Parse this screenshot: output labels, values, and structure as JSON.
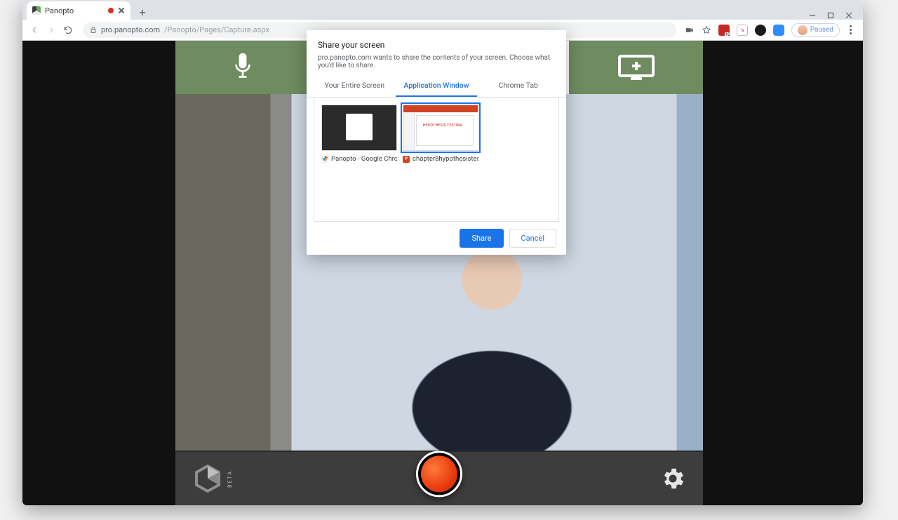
{
  "browser": {
    "tab_title": "Panopto",
    "url_host": "pro.panopto.com",
    "url_path": "/Panopto/Pages/Capture.aspx",
    "paused_label": "Paused"
  },
  "panopto": {
    "beta_label": "BETA"
  },
  "dialog": {
    "title": "Share your screen",
    "subtitle": "pro.panopto.com wants to share the contents of your screen. Choose what you'd like to share.",
    "tabs": {
      "entire": "Your Entire Screen",
      "window": "Application Window",
      "chrome": "Chrome Tab"
    },
    "windows": [
      {
        "label": "Panopto - Google Chro..."
      },
      {
        "label": "chapter8hypothesistes..."
      }
    ],
    "share_label": "Share",
    "cancel_label": "Cancel"
  }
}
